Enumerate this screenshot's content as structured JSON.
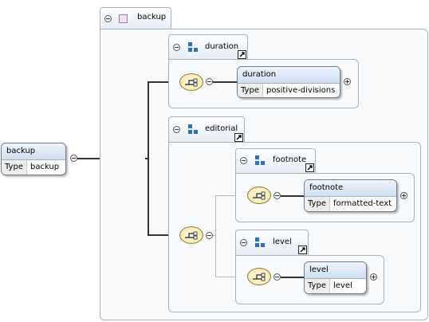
{
  "root": {
    "name": "backup",
    "type_key": "Type",
    "type_value": "backup"
  },
  "backup_group": {
    "title": "backup"
  },
  "duration_group": {
    "title": "duration",
    "element": {
      "name": "duration",
      "type_key": "Type",
      "type_value": "positive-divisions"
    }
  },
  "editorial_group": {
    "title": "editorial",
    "footnote_group": {
      "title": "footnote",
      "element": {
        "name": "footnote",
        "type_key": "Type",
        "type_value": "formatted-text"
      }
    },
    "level_group": {
      "title": "level",
      "element": {
        "name": "level",
        "type_key": "Type",
        "type_value": "level"
      }
    }
  },
  "icons": {
    "group": "model-group-icon",
    "attribute_group": "attribute-group-icon",
    "link": "reference-arrow-icon",
    "sequence": "sequence-compositor-icon"
  },
  "colors": {
    "connector": "#333333",
    "group_border": "#a8b2bd",
    "card_header": "#cfe0f1",
    "sequence_fill": "#f3e39a"
  }
}
